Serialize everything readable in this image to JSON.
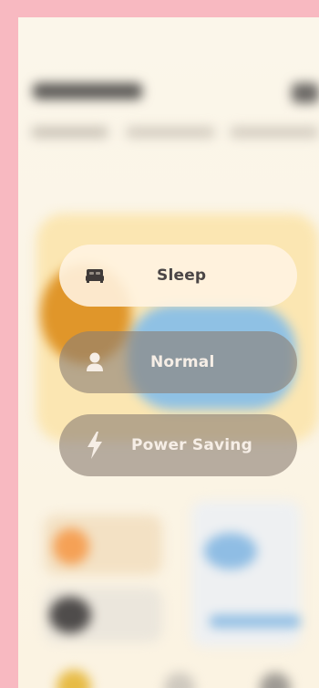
{
  "modes": [
    {
      "label": "Sleep",
      "icon": "bed-icon",
      "active": true
    },
    {
      "label": "Normal",
      "icon": "person-icon",
      "active": false
    },
    {
      "label": "Power Saving",
      "icon": "lightning-icon",
      "active": false
    }
  ],
  "colors": {
    "frame": "#f8b9c1",
    "active_pill": "#fff4e2",
    "inactive_pill": "#8c8074",
    "active_text": "#4b4646",
    "inactive_text": "#f6eee6"
  }
}
